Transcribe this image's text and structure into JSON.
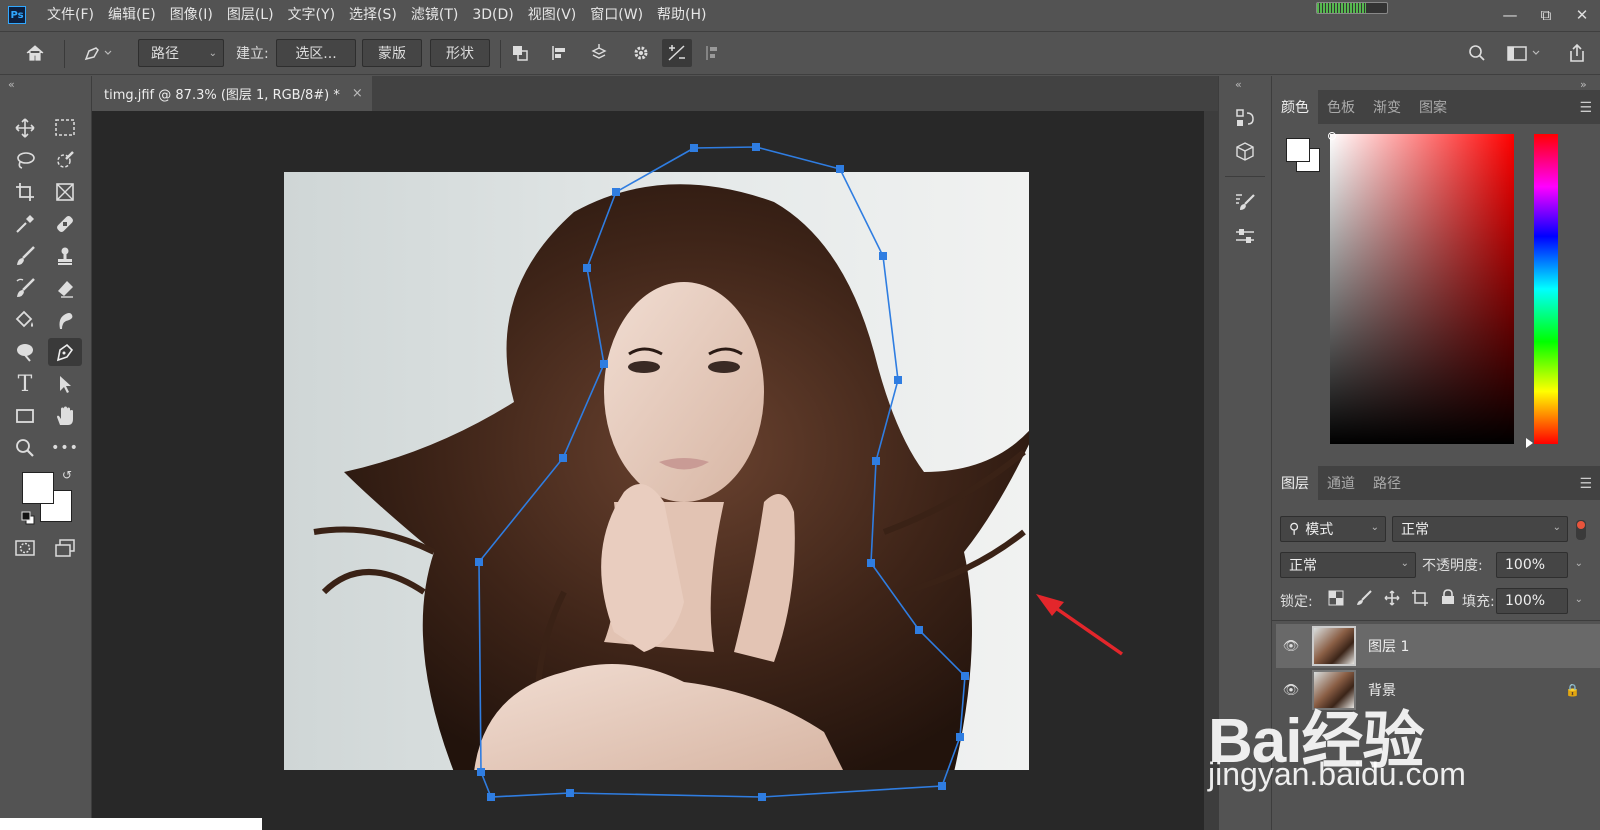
{
  "menubar": {
    "app_icon": "Ps",
    "items": [
      "文件(F)",
      "编辑(E)",
      "图像(I)",
      "图层(L)",
      "文字(Y)",
      "选择(S)",
      "滤镜(T)",
      "3D(D)",
      "视图(V)",
      "窗口(W)",
      "帮助(H)"
    ],
    "window_controls": [
      "minimize-icon",
      "restore-icon",
      "close-icon"
    ]
  },
  "options_bar": {
    "mode_select": "路径",
    "make_label": "建立:",
    "selection_button": "选区...",
    "mask_button": "蒙版",
    "shape_button": "形状"
  },
  "document": {
    "tab_title": "timg.jfif @ 87.3% (图层 1, RGB/8#) *",
    "tab_close": "×"
  },
  "tools": {
    "items": [
      "move-tool",
      "marquee-tool",
      "lasso-tool",
      "quick-select-tool",
      "crop-tool",
      "frame-tool",
      "eyedropper-tool",
      "healing-brush-tool",
      "brush-tool",
      "clone-stamp-tool",
      "history-brush-tool",
      "eraser-tool",
      "paint-bucket-tool",
      "smudge-tool",
      "dodge-tool",
      "pen-tool",
      "type-tool",
      "path-selection-tool",
      "rectangle-tool",
      "hand-tool",
      "zoom-tool",
      "more-tools",
      "quick-mask",
      "screen-mode"
    ],
    "active": "pen-tool",
    "type_glyph": "T",
    "more_glyph": "•••",
    "foreground_color": "#ffffff",
    "background_color": "#ffffff"
  },
  "color_panel": {
    "tabs": [
      "颜色",
      "色板",
      "渐变",
      "图案"
    ],
    "active_tab": "颜色",
    "hue": "#ff0000"
  },
  "layers_panel": {
    "tabs": [
      "图层",
      "通道",
      "路径"
    ],
    "active_tab": "图层",
    "filter_kind": "模式",
    "filter_value": "正常",
    "blend_mode": "正常",
    "opacity_label": "不透明度:",
    "opacity_value": "100%",
    "lock_label": "锁定:",
    "fill_label": "填充:",
    "fill_value": "100%",
    "layers": [
      {
        "name": "图层 1",
        "visible": true,
        "locked": false,
        "selected": true
      },
      {
        "name": "背景",
        "visible": true,
        "locked": true,
        "selected": false
      }
    ]
  },
  "watermark": {
    "brand": "Bai经验",
    "url": "jingyan.baidu.com"
  },
  "colors": {
    "accent_path": "#2f7de1",
    "arrow": "#e3262b"
  }
}
